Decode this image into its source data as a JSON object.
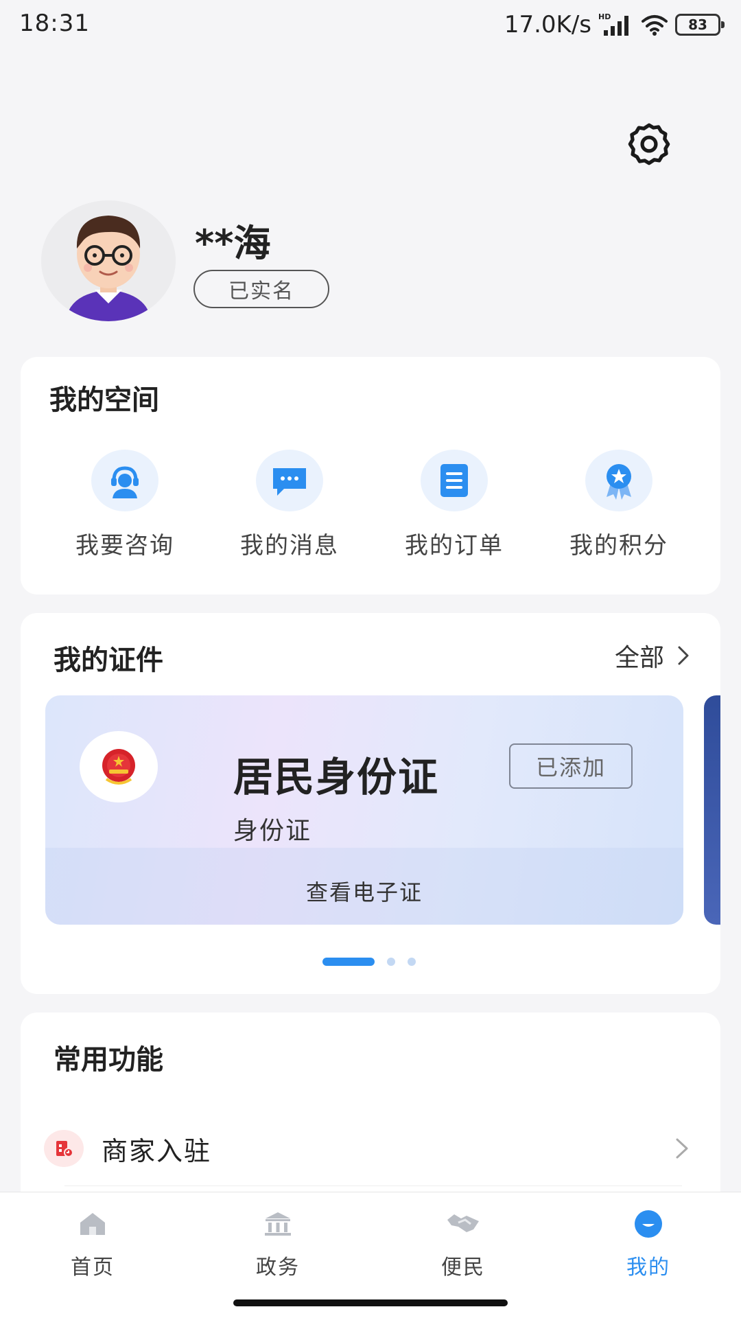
{
  "status_bar": {
    "time": "18:31",
    "network_speed": "17.0K/s",
    "battery": "83",
    "icons": [
      "hd-signal-icon",
      "wifi-icon",
      "battery-icon"
    ]
  },
  "profile": {
    "name": "**海",
    "verified_label": "已实名"
  },
  "my_space": {
    "title": "我的空间",
    "items": [
      {
        "label": "我要咨询",
        "icon": "consult-headset-icon"
      },
      {
        "label": "我的消息",
        "icon": "message-bubble-icon"
      },
      {
        "label": "我的订单",
        "icon": "order-list-icon"
      },
      {
        "label": "我的积分",
        "icon": "points-badge-icon"
      }
    ]
  },
  "certificates": {
    "title": "我的证件",
    "view_all": "全部",
    "card": {
      "title": "居民身份证",
      "subtitle": "身份证",
      "status": "已添加",
      "action": "查看电子证"
    },
    "pager": {
      "count": 3,
      "active": 1
    }
  },
  "common_functions": {
    "title": "常用功能",
    "items": [
      {
        "label": "商家入驻",
        "icon": "merchant-icon"
      }
    ]
  },
  "bottom_nav": {
    "items": [
      {
        "label": "首页",
        "icon": "home-icon"
      },
      {
        "label": "政务",
        "icon": "government-icon"
      },
      {
        "label": "便民",
        "icon": "handshake-icon"
      },
      {
        "label": "我的",
        "icon": "profile-icon",
        "active": true
      }
    ]
  },
  "colors": {
    "accent": "#2b8ef0",
    "background": "#f5f5f7",
    "icon_circle": "#eaf2fd"
  }
}
